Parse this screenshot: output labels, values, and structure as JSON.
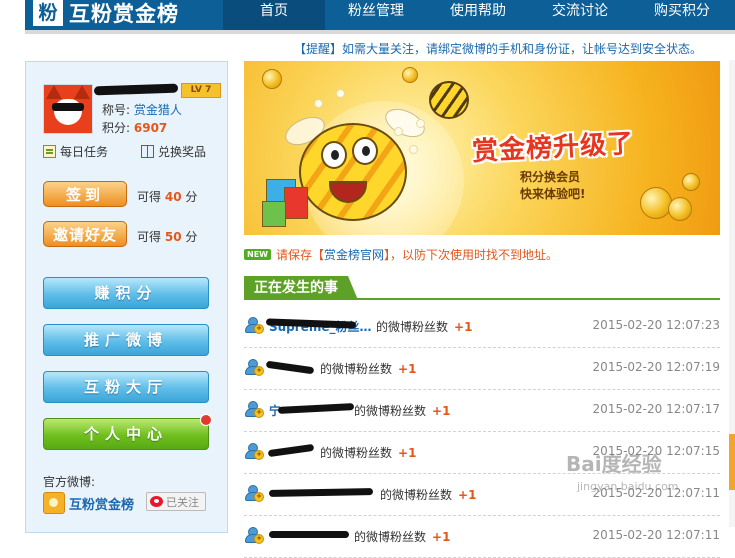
{
  "header": {
    "logo_char": "粉",
    "site_name": "互粉赏金榜",
    "nav": [
      "首页",
      "粉丝管理",
      "使用帮助",
      "交流讨论",
      "购买积分"
    ]
  },
  "notice": "【提醒】如需大量关注，请绑定微博的手机和身份证，让帐号达到安全状态。",
  "profile": {
    "level": "LV 7",
    "title_label": "称号:",
    "title_value": "赏金猎人",
    "points_label": "积分:",
    "points_value": "6907",
    "daily_task": "每日任务",
    "redeem": "兑换奖品"
  },
  "rewards": {
    "checkin_label": "签到",
    "checkin_pre": "可得",
    "checkin_num": "40",
    "checkin_unit": "分",
    "invite_label": "邀请好友",
    "invite_pre": "可得",
    "invite_num": "50",
    "invite_unit": "分"
  },
  "menu": {
    "earn": "赚积分",
    "promote": "推广微博",
    "hall": "互粉大厅",
    "center": "个人中心"
  },
  "official": {
    "label": "官方微博:",
    "name": "互粉赏金榜",
    "follow_state": "已关注"
  },
  "banner": {
    "title": "赏金榜升级了",
    "sub_line1": "积分换会员",
    "sub_line2": "快来体验吧!"
  },
  "tip": {
    "new_tag": "NEW",
    "text_before": "请保存【",
    "link": "赏金榜官网",
    "text_after": "】，以防下次使用时找不到地址。"
  },
  "section_title": "正在发生的事",
  "feed": [
    {
      "user": "Supreme_粉丝…",
      "action": "的微博粉丝数",
      "delta": "+1",
      "time": "2015-02-20 12:07:23"
    },
    {
      "user": "",
      "action": "的微博粉丝数",
      "delta": "+1",
      "time": "2015-02-20 12:07:19"
    },
    {
      "user": "宁",
      "action": "的微博粉丝数",
      "delta": "+1",
      "time": "2015-02-20 12:07:17"
    },
    {
      "user": "",
      "action": "的微博粉丝数",
      "delta": "+1",
      "time": "2015-02-20 12:07:15"
    },
    {
      "user": "",
      "action": "的微博粉丝数",
      "delta": "+1",
      "time": "2015-02-20 12:07:11"
    },
    {
      "user": "",
      "action": "的微博粉丝数",
      "delta": "+1",
      "time": "2015-02-20 12:07:11"
    }
  ],
  "watermark": {
    "main": "Bai度经验",
    "sub": "jingyan.baidu.com"
  },
  "colors": {
    "header_blue": "#0d5f97",
    "link_blue": "#1a69b0",
    "accent_orange": "#e4561a",
    "section_green": "#5da227"
  }
}
